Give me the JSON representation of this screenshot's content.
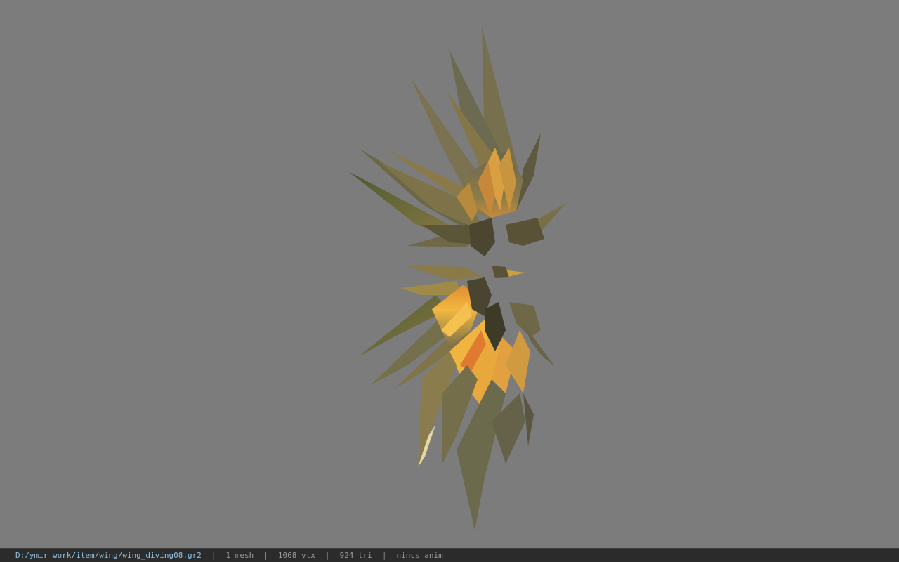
{
  "viewer": {
    "background_color": "#7c7c7c",
    "model": {
      "name": "wing-model",
      "feather_colors": [
        "#6e6a4c",
        "#8a7a48",
        "#c99a3e",
        "#f0b040",
        "#e07a30",
        "#4e5a34",
        "#e6d6a6"
      ]
    }
  },
  "status_bar": {
    "file_path": "D:/ymir work/item/wing/wing_diving08.gr2",
    "separator": "|",
    "mesh_count": "1 mesh",
    "vertex_count": "1068 vtx",
    "triangle_count": "924 tri",
    "animation_status": "nincs anim"
  }
}
